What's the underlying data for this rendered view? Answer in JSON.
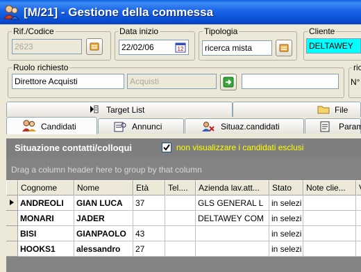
{
  "window": {
    "title": "[M/21] - Gestione della commessa"
  },
  "header": {
    "rif_codice": {
      "label": "Rif./Codice",
      "value": "2623"
    },
    "data_inizio": {
      "label": "Data inizio",
      "value": "22/02/06",
      "calendar_day": "12"
    },
    "tipologia": {
      "label": "Tipologia",
      "value": "ricerca mista"
    },
    "cliente": {
      "label": "Cliente",
      "value": "DELTAWEY"
    },
    "ruolo": {
      "label": "Ruolo richiesto",
      "value": "Direttore Acquisti",
      "secondary": "Acquisti",
      "extra": ""
    },
    "right_partial": {
      "label": "ric",
      "value": "N°"
    }
  },
  "tabs_top": [
    {
      "label": "Target List",
      "icon": "target-list-icon"
    },
    {
      "label": "File",
      "icon": "folder-icon"
    }
  ],
  "tabs_bottom": [
    {
      "label": "Candidati",
      "icon": "candidates-icon",
      "active": true
    },
    {
      "label": "Annunci",
      "icon": "announcements-icon",
      "active": false
    },
    {
      "label": "Situaz.candidati",
      "icon": "candidate-status-icon",
      "active": false
    },
    {
      "label": "Param",
      "icon": "parameters-icon",
      "active": false
    }
  ],
  "panel": {
    "title": "Situazione contatti/colloqui",
    "checkbox_label": "non visualizzare i candidati esclusi",
    "checkbox_checked": true,
    "group_hint": "Drag a column header here to group by that column"
  },
  "grid": {
    "columns": [
      "Cognome",
      "Nome",
      "Età",
      "Tel....",
      "Azienda lav.att...",
      "Stato",
      "Note clie...",
      "V"
    ],
    "rows": [
      {
        "current": true,
        "cells": [
          "ANDREOLI",
          "GIAN LUCA",
          "37",
          "",
          "GLS GENERAL L",
          "in selezi",
          "",
          ""
        ]
      },
      {
        "current": false,
        "cells": [
          "MONARI",
          "JADER",
          "",
          "",
          "DELTAWEY COM",
          "in selezi",
          "",
          ""
        ]
      },
      {
        "current": false,
        "cells": [
          "BISI",
          "GIANPAOLO",
          "43",
          "",
          "",
          "in selezi",
          "",
          ""
        ]
      },
      {
        "current": false,
        "cells": [
          "HOOKS1",
          "alessandro",
          "27",
          "",
          "",
          "in selezi",
          "",
          ""
        ]
      }
    ]
  },
  "colors": {
    "titlebar": "#0a4fd4",
    "cliente_bg": "#00ffff",
    "panel_header": "#7f7f7f",
    "checkbox_label": "#ffff00"
  }
}
